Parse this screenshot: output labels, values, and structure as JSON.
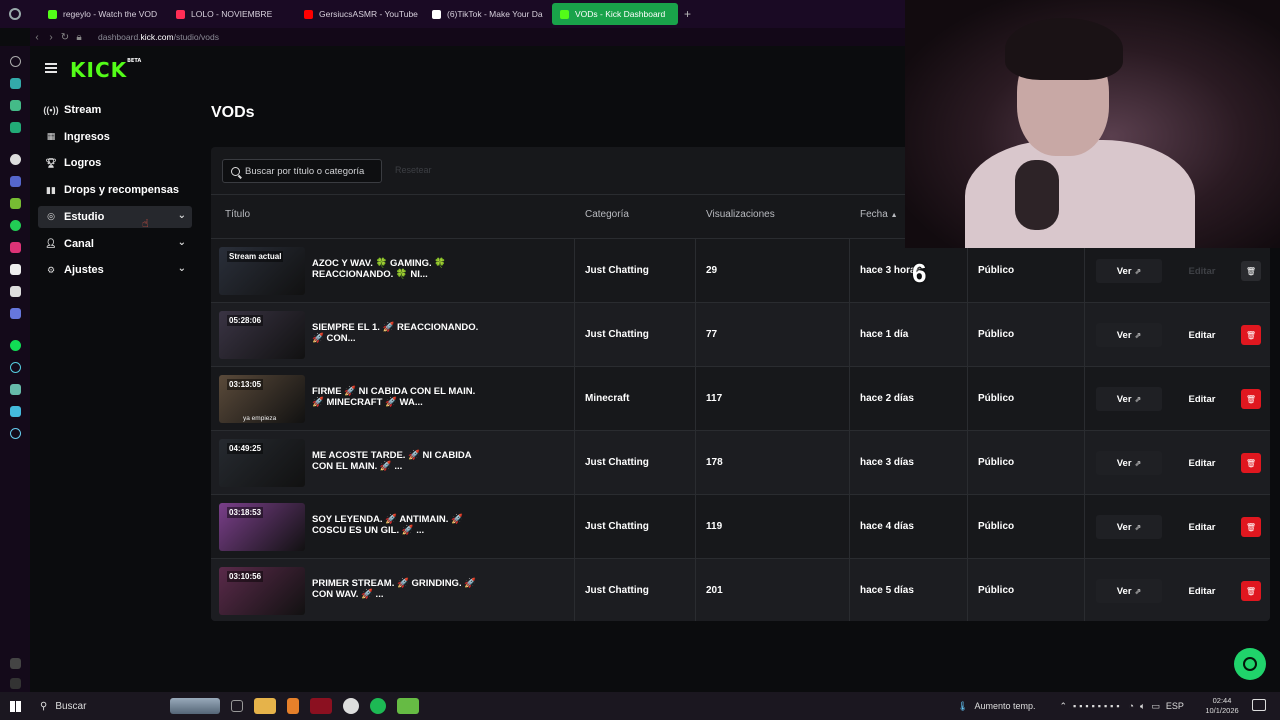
{
  "browser": {
    "tabs": [
      {
        "label": "regeylo - Watch the VOD",
        "icon_color": "#53fc18",
        "active": false
      },
      {
        "label": "LOLO - NOVIEMBRE",
        "icon_color": "#ff2d55",
        "active": false
      },
      {
        "label": "GersiucsASMR - YouTube",
        "icon_color": "#ff0000",
        "active": false
      },
      {
        "label": "(6)TikTok - Make Your Da",
        "icon_color": "#ffffff",
        "active": false
      },
      {
        "label": "VODs - Kick Dashboard",
        "icon_color": "#53fc18",
        "active": true
      }
    ],
    "new_tab": "+",
    "url_prefix": "dashboard.",
    "url_domain": "kick.com",
    "url_path": "/studio/vods"
  },
  "app": {
    "logo": "KICK",
    "logo_badge": "BETA",
    "brand_color": "#53fc18",
    "page_title": "VODs",
    "sidebar": [
      {
        "label": "Stream",
        "icon": "stream-icon",
        "has_chevron": false
      },
      {
        "label": "Ingresos",
        "icon": "revenue-icon",
        "has_chevron": false
      },
      {
        "label": "Logros",
        "icon": "trophy-icon",
        "has_chevron": false
      },
      {
        "label": "Drops y recompensas",
        "icon": "gift-icon",
        "has_chevron": false
      },
      {
        "label": "Estudio",
        "icon": "studio-icon",
        "has_chevron": true,
        "selected": true
      },
      {
        "label": "Canal",
        "icon": "person-icon",
        "has_chevron": true
      },
      {
        "label": "Ajustes",
        "icon": "gear-icon",
        "has_chevron": true
      }
    ],
    "search": {
      "placeholder": "Buscar por título o categoría"
    },
    "reset_label": "Resetear",
    "columns": {
      "title": "Título",
      "category": "Categoría",
      "views": "Visualizaciones",
      "date": "Fecha",
      "date_sort": "▲"
    },
    "rows": [
      {
        "thumb_label": "Stream actual",
        "title": "AZOC Y WAV. 🍀 GAMING. 🍀 REACCIONANDO. 🍀 NI...",
        "category": "Just Chatting",
        "views": "29",
        "date": "hace 3 horas",
        "visibility": "Público",
        "view_label": "Ver",
        "edit_label": "Editar",
        "edit_disabled": true,
        "thumb_color": "#2a2f3a"
      },
      {
        "thumb_label": "05:28:06",
        "title": "SIEMPRE EL 1. 🚀 REACCIONANDO. 🚀 CON...",
        "category": "Just Chatting",
        "views": "77",
        "date": "hace 1 día",
        "visibility": "Público",
        "view_label": "Ver",
        "edit_label": "Editar",
        "edit_disabled": false,
        "thumb_color": "#3a3444"
      },
      {
        "thumb_label": "03:13:05",
        "thumb_caption": "ya empieza",
        "title": "FIRME 🚀 NI CABIDA CON EL MAIN. 🚀 MINECRAFT 🚀 WA...",
        "category": "Minecraft",
        "views": "117",
        "date": "hace 2 días",
        "visibility": "Público",
        "view_label": "Ver",
        "edit_label": "Editar",
        "edit_disabled": false,
        "thumb_color": "#5a4a3a"
      },
      {
        "thumb_label": "04:49:25",
        "title": "ME ACOSTE TARDE. 🚀 NI CABIDA CON EL MAIN. 🚀 ...",
        "category": "Just Chatting",
        "views": "178",
        "date": "hace 3 días",
        "visibility": "Público",
        "view_label": "Ver",
        "edit_label": "Editar",
        "edit_disabled": false,
        "thumb_color": "#262a30"
      },
      {
        "thumb_label": "03:18:53",
        "title": "SOY LEYENDA. 🚀 ANTIMAIN. 🚀 COSCU ES UN GIL. 🚀 ...",
        "category": "Just Chatting",
        "views": "119",
        "date": "hace 4 días",
        "visibility": "Público",
        "view_label": "Ver",
        "edit_label": "Editar",
        "edit_disabled": false,
        "thumb_color": "#7a3f8a"
      },
      {
        "thumb_label": "03:10:56",
        "title": "PRIMER STREAM. 🚀 GRINDING. 🚀 CON WAV. 🚀 ...",
        "category": "Just Chatting",
        "views": "201",
        "date": "hace 5 días",
        "visibility": "Público",
        "view_label": "Ver",
        "edit_label": "Editar",
        "edit_disabled": false,
        "thumb_color": "#5a2a4a"
      }
    ],
    "overlay_number": "6",
    "delete_color": "#e0171f"
  },
  "taskbar": {
    "search_label": "Buscar",
    "weather": "Aumento temp.",
    "language": "ESP",
    "time": "02:44",
    "date": "10/1/2026"
  }
}
